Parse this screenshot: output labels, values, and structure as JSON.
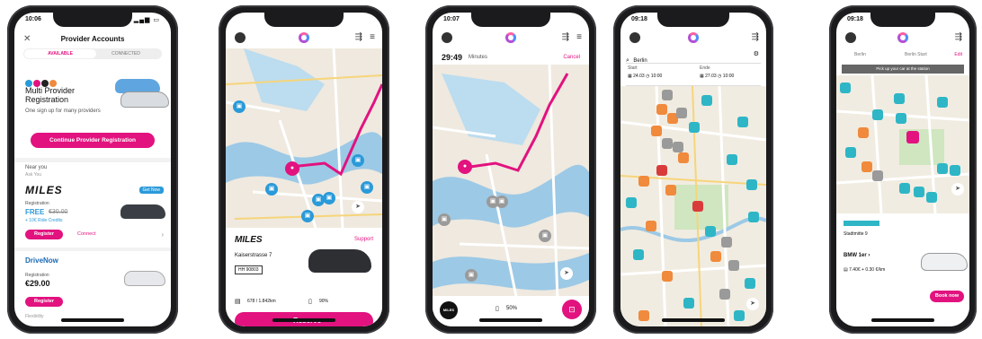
{
  "p1": {
    "time": "10:06",
    "title": "Provider Accounts",
    "tab_available": "AVAILABLE",
    "tab_connected": "CONNECTED",
    "promo_title": "Multi Provider Registration",
    "promo_sub": "One sign up for many providers",
    "cta": "Continue Provider Registration",
    "section": "Near you",
    "section_sub": "Ask You",
    "miles_logo": "MILES",
    "miles_badge": "Get Now",
    "reg_label": "Registration",
    "miles_price": "FREE",
    "miles_old_price": "€30.00",
    "miles_note": "+ 10€ Ride Credits",
    "register": "Register",
    "connect": "Connect",
    "drivenow": "DriveNow",
    "dn_reg": "Registration",
    "dn_price": "€29.00",
    "register2": "Register",
    "footer": "Flexibility"
  },
  "p2": {
    "brand": "MILES",
    "support": "Support",
    "address": "Kaiserstrasse 7",
    "plate": "HH 90803",
    "distance": "678 / 1.842km",
    "fuel": "90%",
    "reserve": "Reserve"
  },
  "p3": {
    "time": "10:07",
    "minutes": "29:49",
    "minutes_label": "Minutes",
    "cancel": "Cancel",
    "fuel": "50%",
    "brand": "MILES"
  },
  "p4": {
    "time": "09:18",
    "search": "Berlin",
    "start_label": "Start",
    "start_date": "24.03",
    "start_time": "10:00",
    "end_label": "Ende",
    "end_date": "27.03",
    "end_time": "10:00"
  },
  "p5": {
    "time": "09:18",
    "edit": "Edit",
    "search_a": "Berlin",
    "search_b": "Berlin Start",
    "notice": "Pick up your car at the station",
    "station_name": "Stadtmitte 9",
    "car_model": "BMW 1er",
    "car_spec": "7.40€ + 0.30 €/km",
    "book": "Book now"
  },
  "colors": {
    "accent": "#e2127f",
    "station": "#2eb6c6",
    "alt": "#f08a3c"
  }
}
